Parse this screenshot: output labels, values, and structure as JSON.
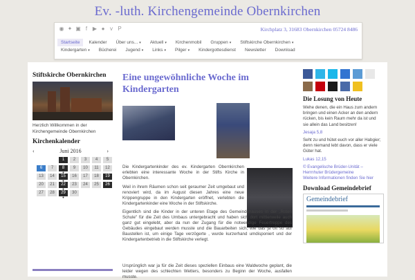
{
  "site": {
    "title": "Ev. -luth. Kirchengemeinde Obernkirchen",
    "address": "Kirchplatz 3, 31683 Obernkirchen 05724 8486"
  },
  "menu_row1": [
    {
      "label": "Startseite",
      "caret": false,
      "active": true
    },
    {
      "label": "Kalender",
      "caret": false
    },
    {
      "label": "Über uns...",
      "caret": true
    },
    {
      "label": "Aktuell",
      "caret": true
    },
    {
      "label": "Kirchenmobil",
      "caret": false
    },
    {
      "label": "Gruppen",
      "caret": true
    },
    {
      "label": "Stiftskirche Obernkirchen",
      "caret": true
    }
  ],
  "menu_row2": [
    {
      "label": "Kindergarten",
      "caret": true
    },
    {
      "label": "Bücherei",
      "caret": false
    },
    {
      "label": "Jugend",
      "caret": true
    },
    {
      "label": "Links",
      "caret": true
    },
    {
      "label": "Pilger",
      "caret": true
    },
    {
      "label": "Kindergottesdienst",
      "caret": false
    },
    {
      "label": "Newsletter",
      "caret": false
    },
    {
      "label": "Download",
      "caret": false
    }
  ],
  "caret_glyph": "▾",
  "social_icons": [
    "rss-icon",
    "twitter-icon",
    "instagram-icon",
    "facebook-icon",
    "youtube-icon",
    "flickr-icon",
    "vimeo-icon",
    "pinterest-icon"
  ],
  "social_glyphs": [
    "◉",
    "✦",
    "▣",
    "f",
    "▶",
    "●",
    "v",
    "P"
  ],
  "left": {
    "church_title": "Stiftskirche Obernkirchen",
    "welcome": "Herzlich Willkommen in der Kirchengemeinde Obernkirchen",
    "calendar_title": "Kirchenkalender",
    "month": "Juni 2016",
    "prev": "‹",
    "next": "›"
  },
  "calendar": [
    {
      "d": "",
      "t": "empty"
    },
    {
      "d": "",
      "t": "empty"
    },
    {
      "d": "1",
      "t": "dark"
    },
    {
      "d": "2",
      "t": ""
    },
    {
      "d": "3",
      "t": ""
    },
    {
      "d": "4",
      "t": ""
    },
    {
      "d": "5",
      "t": ""
    },
    {
      "d": "6",
      "t": "today"
    },
    {
      "d": "7",
      "t": ""
    },
    {
      "d": "8",
      "t": "dark dot"
    },
    {
      "d": "9",
      "t": ""
    },
    {
      "d": "10",
      "t": ""
    },
    {
      "d": "11",
      "t": ""
    },
    {
      "d": "12",
      "t": ""
    },
    {
      "d": "13",
      "t": ""
    },
    {
      "d": "14",
      "t": ""
    },
    {
      "d": "15",
      "t": "dark dot"
    },
    {
      "d": "16",
      "t": ""
    },
    {
      "d": "17",
      "t": ""
    },
    {
      "d": "18",
      "t": ""
    },
    {
      "d": "19",
      "t": "dark"
    },
    {
      "d": "20",
      "t": ""
    },
    {
      "d": "21",
      "t": ""
    },
    {
      "d": "22",
      "t": "dark dot"
    },
    {
      "d": "23",
      "t": ""
    },
    {
      "d": "24",
      "t": ""
    },
    {
      "d": "25",
      "t": ""
    },
    {
      "d": "26",
      "t": "dark"
    },
    {
      "d": "27",
      "t": ""
    },
    {
      "d": "28",
      "t": ""
    },
    {
      "d": "29",
      "t": "dark dot"
    },
    {
      "d": "30",
      "t": ""
    },
    {
      "d": "",
      "t": "empty"
    },
    {
      "d": "",
      "t": "empty"
    },
    {
      "d": "",
      "t": "empty"
    }
  ],
  "post": {
    "title": "Eine ungewöhnliche Woche im Kindergarten",
    "p1": "Die Kindergartenkinder des ev. Kindergarten Obernkirchen erlebten eine interessante Woche in der Stifts Kirche in Obernkirchen.",
    "p2": "Weil in ihrem Räumen schon seit geraumer Zeit umgebaut und renoviert wird, da im August diesen Jahres eine neue Krippengruppe in den Kindergarten eröffnet, verlebten die Kindergartenkinder eine Woche in der Stiftskirche.",
    "p3": "Eigentlich sind die Kinder in der unteren Etage des Gemeindehauses in der „Roten Schule\" für die Zeit des Umbaus untergebracht und haben sich dort mittlerweile auch ganz gut eingelebt, aber da nun der Zugang für die notwendige Feuertreppe des Gebäudes eingebaut werden musste und die Bauarbeiten sich, wie das ja oft so  auf Baustellen ist, um einige Tage verzögerte , wurde kurzerhand umdisponiert und der Kindergartenbetrieb in die Stiftskirche verlegt.",
    "p4": "Ursprünglich war ja für die Zeit dieses speziellen Einbaus eine Waldwoche geplant, die leider wegen des schlechten Wetters, besonders zu Beginn der Woche, ausfallen musste."
  },
  "right": {
    "losung_title": "Die Losung von Heute",
    "losung1": "Wehe denen, die ein Haus zum andern bringen und einen Acker an den andern rücken, bis kein Raum mehr da ist und sie allein das Land besitzen!",
    "ref1": "Jesaja 5,8",
    "losung2": "Seht zu und hütet euch vor aller Habgier; denn niemand lebt davon, dass er viele Güter hat.",
    "ref2": "Lukas 12,15",
    "copyright": "© Evangelische Brüder-Unität – Herrnhuter Brüdergemeine",
    "more": "Weitere Informationen finden Sie hier",
    "download_title": "Download Gemeindebrief",
    "gb_title": "Gemeindebrief"
  },
  "right_icons": [
    {
      "name": "facebook-icon",
      "color": "#3b5998"
    },
    {
      "name": "twitter-icon",
      "color": "#2fb5e8"
    },
    {
      "name": "vimeo-icon",
      "color": "#1ab7ea"
    },
    {
      "name": "delicious-icon",
      "color": "#3274d1"
    },
    {
      "name": "check-icon",
      "color": "#5b9bd5"
    },
    {
      "name": "flickr-icon",
      "color": "#e8e8e8"
    },
    {
      "name": "instagram-icon",
      "color": "#8a6a4a"
    },
    {
      "name": "lastfm-icon",
      "color": "#c3000d"
    },
    {
      "name": "myspace-icon",
      "color": "#1a1a1a"
    },
    {
      "name": "home-icon",
      "color": "#4a6aa8"
    },
    {
      "name": "bookmark-icon",
      "color": "#f0c020"
    }
  ],
  "colors": {
    "accent": "#6a6acf"
  }
}
